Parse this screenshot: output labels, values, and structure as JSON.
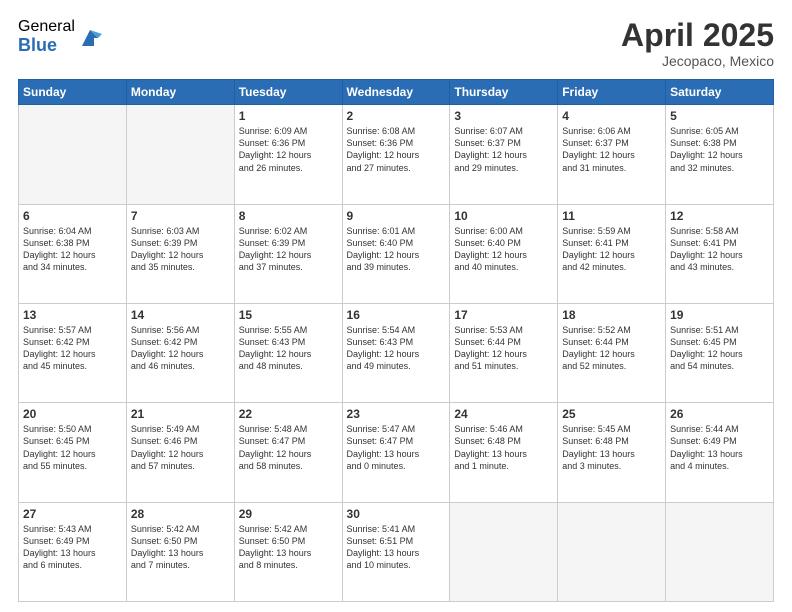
{
  "header": {
    "logo": {
      "general": "General",
      "blue": "Blue"
    },
    "title": "April 2025",
    "location": "Jecopaco, Mexico"
  },
  "weekdays": [
    "Sunday",
    "Monday",
    "Tuesday",
    "Wednesday",
    "Thursday",
    "Friday",
    "Saturday"
  ],
  "weeks": [
    [
      {
        "day": "",
        "info": ""
      },
      {
        "day": "",
        "info": ""
      },
      {
        "day": "1",
        "info": "Sunrise: 6:09 AM\nSunset: 6:36 PM\nDaylight: 12 hours\nand 26 minutes."
      },
      {
        "day": "2",
        "info": "Sunrise: 6:08 AM\nSunset: 6:36 PM\nDaylight: 12 hours\nand 27 minutes."
      },
      {
        "day": "3",
        "info": "Sunrise: 6:07 AM\nSunset: 6:37 PM\nDaylight: 12 hours\nand 29 minutes."
      },
      {
        "day": "4",
        "info": "Sunrise: 6:06 AM\nSunset: 6:37 PM\nDaylight: 12 hours\nand 31 minutes."
      },
      {
        "day": "5",
        "info": "Sunrise: 6:05 AM\nSunset: 6:38 PM\nDaylight: 12 hours\nand 32 minutes."
      }
    ],
    [
      {
        "day": "6",
        "info": "Sunrise: 6:04 AM\nSunset: 6:38 PM\nDaylight: 12 hours\nand 34 minutes."
      },
      {
        "day": "7",
        "info": "Sunrise: 6:03 AM\nSunset: 6:39 PM\nDaylight: 12 hours\nand 35 minutes."
      },
      {
        "day": "8",
        "info": "Sunrise: 6:02 AM\nSunset: 6:39 PM\nDaylight: 12 hours\nand 37 minutes."
      },
      {
        "day": "9",
        "info": "Sunrise: 6:01 AM\nSunset: 6:40 PM\nDaylight: 12 hours\nand 39 minutes."
      },
      {
        "day": "10",
        "info": "Sunrise: 6:00 AM\nSunset: 6:40 PM\nDaylight: 12 hours\nand 40 minutes."
      },
      {
        "day": "11",
        "info": "Sunrise: 5:59 AM\nSunset: 6:41 PM\nDaylight: 12 hours\nand 42 minutes."
      },
      {
        "day": "12",
        "info": "Sunrise: 5:58 AM\nSunset: 6:41 PM\nDaylight: 12 hours\nand 43 minutes."
      }
    ],
    [
      {
        "day": "13",
        "info": "Sunrise: 5:57 AM\nSunset: 6:42 PM\nDaylight: 12 hours\nand 45 minutes."
      },
      {
        "day": "14",
        "info": "Sunrise: 5:56 AM\nSunset: 6:42 PM\nDaylight: 12 hours\nand 46 minutes."
      },
      {
        "day": "15",
        "info": "Sunrise: 5:55 AM\nSunset: 6:43 PM\nDaylight: 12 hours\nand 48 minutes."
      },
      {
        "day": "16",
        "info": "Sunrise: 5:54 AM\nSunset: 6:43 PM\nDaylight: 12 hours\nand 49 minutes."
      },
      {
        "day": "17",
        "info": "Sunrise: 5:53 AM\nSunset: 6:44 PM\nDaylight: 12 hours\nand 51 minutes."
      },
      {
        "day": "18",
        "info": "Sunrise: 5:52 AM\nSunset: 6:44 PM\nDaylight: 12 hours\nand 52 minutes."
      },
      {
        "day": "19",
        "info": "Sunrise: 5:51 AM\nSunset: 6:45 PM\nDaylight: 12 hours\nand 54 minutes."
      }
    ],
    [
      {
        "day": "20",
        "info": "Sunrise: 5:50 AM\nSunset: 6:45 PM\nDaylight: 12 hours\nand 55 minutes."
      },
      {
        "day": "21",
        "info": "Sunrise: 5:49 AM\nSunset: 6:46 PM\nDaylight: 12 hours\nand 57 minutes."
      },
      {
        "day": "22",
        "info": "Sunrise: 5:48 AM\nSunset: 6:47 PM\nDaylight: 12 hours\nand 58 minutes."
      },
      {
        "day": "23",
        "info": "Sunrise: 5:47 AM\nSunset: 6:47 PM\nDaylight: 13 hours\nand 0 minutes."
      },
      {
        "day": "24",
        "info": "Sunrise: 5:46 AM\nSunset: 6:48 PM\nDaylight: 13 hours\nand 1 minute."
      },
      {
        "day": "25",
        "info": "Sunrise: 5:45 AM\nSunset: 6:48 PM\nDaylight: 13 hours\nand 3 minutes."
      },
      {
        "day": "26",
        "info": "Sunrise: 5:44 AM\nSunset: 6:49 PM\nDaylight: 13 hours\nand 4 minutes."
      }
    ],
    [
      {
        "day": "27",
        "info": "Sunrise: 5:43 AM\nSunset: 6:49 PM\nDaylight: 13 hours\nand 6 minutes."
      },
      {
        "day": "28",
        "info": "Sunrise: 5:42 AM\nSunset: 6:50 PM\nDaylight: 13 hours\nand 7 minutes."
      },
      {
        "day": "29",
        "info": "Sunrise: 5:42 AM\nSunset: 6:50 PM\nDaylight: 13 hours\nand 8 minutes."
      },
      {
        "day": "30",
        "info": "Sunrise: 5:41 AM\nSunset: 6:51 PM\nDaylight: 13 hours\nand 10 minutes."
      },
      {
        "day": "",
        "info": ""
      },
      {
        "day": "",
        "info": ""
      },
      {
        "day": "",
        "info": ""
      }
    ]
  ]
}
